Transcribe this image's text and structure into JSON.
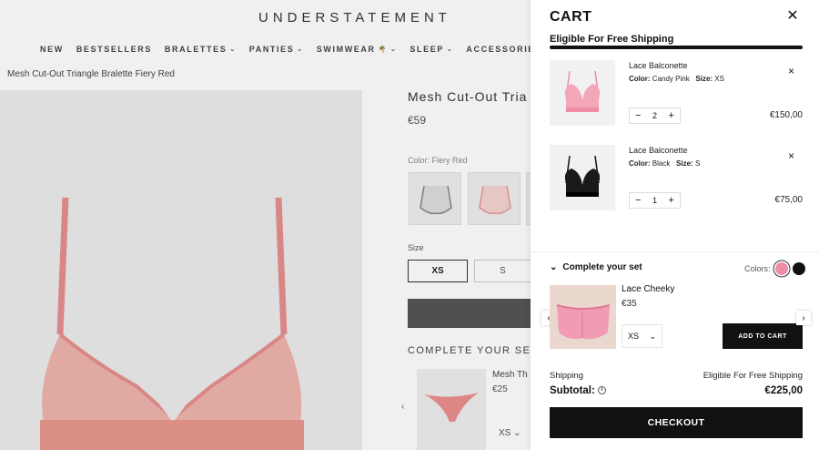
{
  "store": {
    "logo": "UNDERSTATEMENT",
    "nav": [
      {
        "label": "NEW",
        "has_menu": false
      },
      {
        "label": "BESTSELLERS",
        "has_menu": false
      },
      {
        "label": "BRALETTES",
        "has_menu": true
      },
      {
        "label": "PANTIES",
        "has_menu": true
      },
      {
        "label": "SWIMWEAR",
        "has_menu": true
      },
      {
        "label": "SLEEP",
        "has_menu": true
      },
      {
        "label": "ACCESSORIES",
        "has_menu": true
      }
    ],
    "breadcrumb": "Mesh Cut-Out Triangle Bralette Fiery Red",
    "product": {
      "title": "Mesh Cut-Out Tria",
      "price": "€59",
      "color_label": "Color:",
      "color_value": "Fiery Red",
      "size_label": "Size",
      "sizes": [
        "XS",
        "S"
      ],
      "selected_size": "XS",
      "complete_your_set": "COMPLETE YOUR SE",
      "set_item_name": "Mesh Th",
      "set_item_price": "€25",
      "set_item_size": "XS"
    }
  },
  "cart": {
    "title": "CART",
    "shipping_message": "Eligible For Free Shipping",
    "shipping_progress": 1.0,
    "items": [
      {
        "name": "Lace Balconette",
        "color_label": "Color:",
        "color": "Candy Pink",
        "size_label": "Size:",
        "size": "XS",
        "qty": "2",
        "price": "€150,00",
        "swatch": "#f3a6b8"
      },
      {
        "name": "Lace Balconette",
        "color_label": "Color:",
        "color": "Black",
        "size_label": "Size:",
        "size": "S",
        "qty": "1",
        "price": "€75,00",
        "swatch": "#1a1a1a"
      }
    ],
    "complete_set": {
      "heading": "Complete your set",
      "colors_label": "Colors:",
      "colors": [
        "#ee8ca8",
        "#111111"
      ],
      "product_name": "Lace Cheeky",
      "product_price": "€35",
      "size": "XS",
      "add_button": "ADD TO CART"
    },
    "shipping_label": "Shipping",
    "shipping_value": "Eligible For Free Shipping",
    "subtotal_label": "Subtotal:",
    "subtotal_value": "€225,00",
    "checkout_label": "CHECKOUT"
  },
  "icons": {
    "close": "close-icon",
    "remove": "remove-icon",
    "chevron_down": "chevron-down-icon",
    "chevron_left": "chevron-left-icon",
    "chevron_right": "chevron-right-icon",
    "info": "info-icon",
    "minus": "minus-icon",
    "plus": "plus-icon"
  }
}
